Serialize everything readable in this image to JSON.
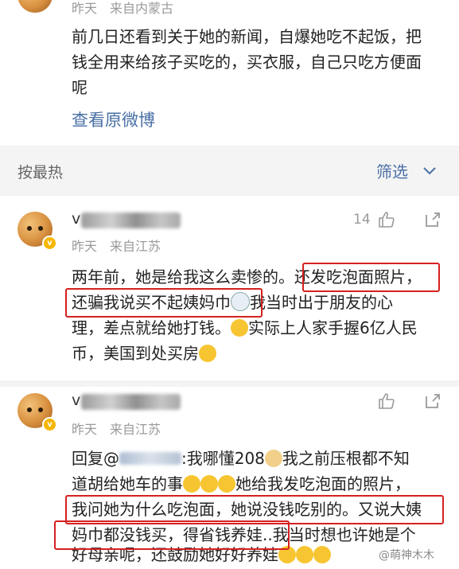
{
  "top_comment": {
    "time": "昨天",
    "location": "来自内蒙古",
    "lines": [
      "前几日还看到关于她的新闻，自爆她吃不起饭，把",
      "钱全用来给孩子买吃的，买衣服，自己只吃方便面",
      "呢"
    ],
    "view_original": "查看原微博"
  },
  "sort_bar": {
    "sort_label": "按最热",
    "filter_label": "筛选"
  },
  "comment1": {
    "name_prefix": "v",
    "like_count": "14",
    "time": "昨天",
    "location": "来自江苏",
    "lines": [
      "两年前，她是给我这么卖惨的。还发吃泡面照片，",
      "还骗我说买不起姨妈巾",
      "我当时出于朋友的心",
      "理，差点就给她打钱。",
      "实际上人家手握6亿人民",
      "币，美国到处买房"
    ]
  },
  "comment2": {
    "name_prefix": "v",
    "time": "昨天",
    "location": "来自江苏",
    "reply_prefix": "回复@",
    "reply_rest": ":我哪懂208",
    "line1_tail": "我之前压根都不知",
    "line2a": "道胡给她车的事",
    "line2b": "她给我发吃泡面的照片，",
    "line3": "我问她为什么吃泡面，她说没钱吃别的。又说大姨",
    "line4a": "妈巾都没钱买，得省钱养娃..",
    "line4b": "我当时想也许她是个",
    "line5": "好母亲呢，还鼓励她好好养娃",
    "watermark": "@萌神木木"
  },
  "colors": {
    "highlight_border": "#d62020",
    "link_blue": "#4a6fa5",
    "meta_gray": "#9a9a9a",
    "sort_bar_bg": "#f4f4f4",
    "badge_gold": "#f5b600"
  }
}
